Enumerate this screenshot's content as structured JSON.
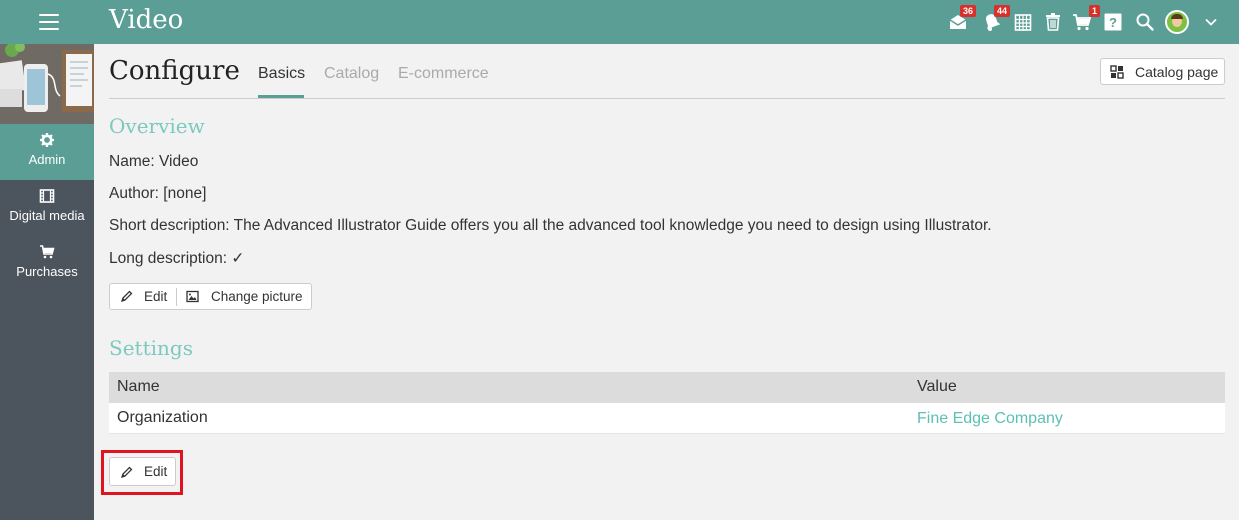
{
  "header": {
    "app_title": "Video",
    "badges": {
      "mail": "36",
      "notifications": "44",
      "cart": "1"
    },
    "icons": [
      "menu-icon",
      "mail-icon",
      "bell-icon",
      "calendar-icon",
      "trash-icon",
      "cart-icon",
      "help-icon",
      "search-icon",
      "avatar",
      "chevron-down-icon"
    ]
  },
  "sidebar": {
    "items": [
      {
        "label": "Admin",
        "icon": "gear-icon",
        "active": true
      },
      {
        "label": "Digital media",
        "icon": "film-icon",
        "active": false
      },
      {
        "label": "Purchases",
        "icon": "cart-icon",
        "active": false
      }
    ]
  },
  "main": {
    "page_title": "Configure",
    "tabs": [
      {
        "label": "Basics",
        "active": true
      },
      {
        "label": "Catalog",
        "active": false
      },
      {
        "label": "E-commerce",
        "active": false
      }
    ],
    "catalog_page_label": "Catalog page",
    "overview": {
      "heading": "Overview",
      "name_line": "Name: Video",
      "author_line": "Author: [none]",
      "short_desc_line": "Short description: The Advanced Illustrator Guide offers you all the advanced tool knowledge you need to design using Illustrator.",
      "long_desc_line": "Long description: ✓",
      "edit_label": "Edit",
      "change_picture_label": "Change picture"
    },
    "settings": {
      "heading": "Settings",
      "columns": [
        "Name",
        "Value"
      ],
      "rows": [
        {
          "name": "Organization",
          "value": "Fine Edge Company"
        }
      ],
      "edit_label": "Edit"
    }
  },
  "colors": {
    "topbar": "#5a9e96",
    "sidebar": "#4c545e",
    "accent": "#7cc9c0",
    "link": "#5cc0b4",
    "badge": "#d9302b",
    "highlight": "#e0141e"
  }
}
